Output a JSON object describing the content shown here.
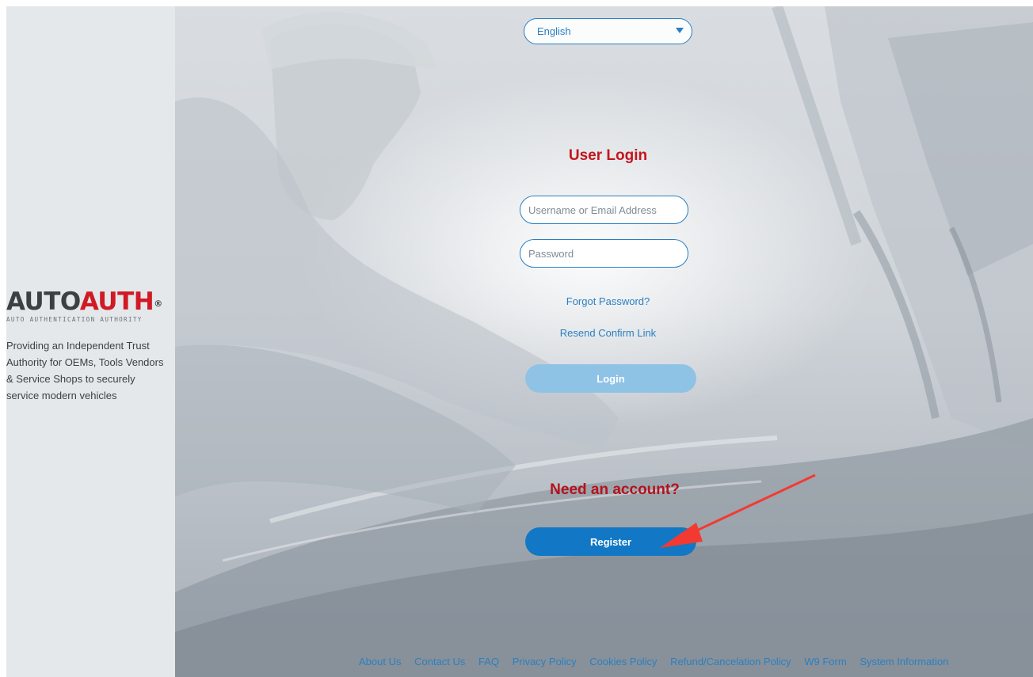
{
  "brand": {
    "logo_word_auto": "AUTO",
    "logo_word_auth": "AUTH",
    "logo_registered": "®",
    "logo_tagline": "AUTO AUTHENTICATION AUTHORITY",
    "description": "Providing an Independent Trust Authority for OEMs, Tools Vendors & Service Shops to securely service modern vehicles",
    "colors": {
      "dark": "#3c4045",
      "red": "#d01a24"
    }
  },
  "language": {
    "selected": "English",
    "icon": "chevron-down-icon"
  },
  "login": {
    "title": "User Login",
    "username_placeholder": "Username or Email Address",
    "password_placeholder": "Password",
    "forgot_link": "Forgot Password?",
    "resend_link": "Resend Confirm Link",
    "login_button": "Login"
  },
  "register": {
    "title": "Need an account?",
    "register_button": "Register"
  },
  "footer": {
    "links": [
      "About Us",
      "Contact Us",
      "FAQ",
      "Privacy Policy",
      "Cookies Policy",
      "Refund/Cancelation Policy",
      "W9 Form",
      "System Information"
    ]
  },
  "colors": {
    "accent": "#2b7fc1",
    "register_button": "#1278c5",
    "login_button": "#8fc3e6",
    "heading_red": "#c4151c",
    "annotation_arrow": "#f23a32"
  }
}
